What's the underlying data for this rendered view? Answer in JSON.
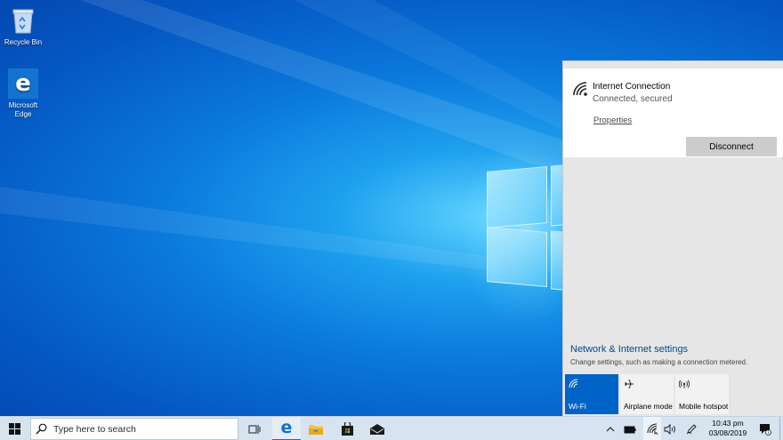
{
  "desktop": {
    "icons": [
      {
        "label": "Recycle Bin"
      },
      {
        "label": "Microsoft Edge"
      }
    ]
  },
  "network_flyout": {
    "connection_name": "Internet Connection",
    "connection_status": "Connected, secured",
    "properties_link": "Properties",
    "disconnect_button": "Disconnect",
    "settings_link": "Network & Internet settings",
    "settings_subtext": "Change settings, such as making a connection metered.",
    "quick_actions": [
      {
        "label": "Wi-Fi",
        "icon": "wifi-icon",
        "active": true
      },
      {
        "label": "Airplane mode",
        "icon": "airplane-icon",
        "active": false
      },
      {
        "label": "Mobile hotspot",
        "icon": "hotspot-icon",
        "active": false
      }
    ]
  },
  "taskbar": {
    "search_placeholder": "Type here to search",
    "pinned_apps": [
      "task-view",
      "microsoft-edge",
      "file-explorer",
      "microsoft-store",
      "mail"
    ],
    "clock_time": "10:43 pm",
    "clock_date": "03/08/2019",
    "notification_count": "1"
  },
  "colors": {
    "accent": "#0063c8",
    "link": "#004a8f",
    "taskbar": "#d7e4f0",
    "flyout_bg": "#e6e6e6"
  }
}
